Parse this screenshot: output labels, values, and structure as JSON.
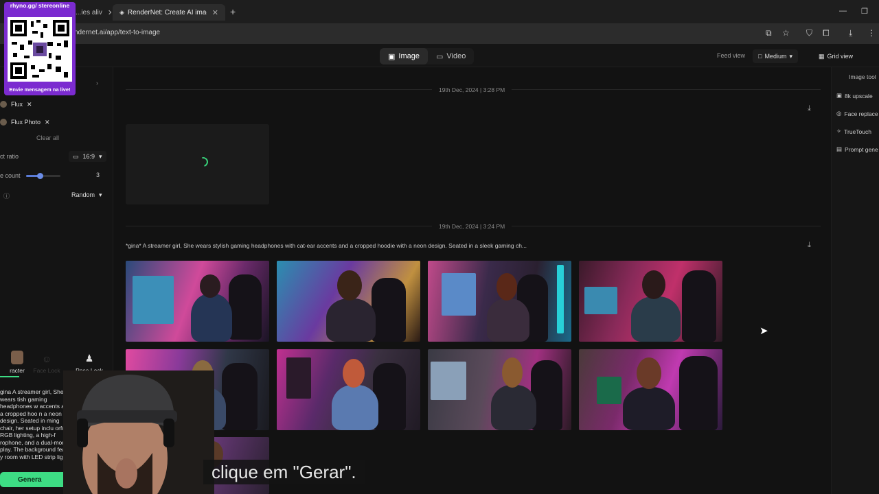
{
  "browser": {
    "tabs": [
      {
        "label": "...ies aliv"
      },
      {
        "label": "RenderNet: Create AI images w"
      }
    ],
    "url": "ndernet.ai/app/text-to-image"
  },
  "header": {
    "modes": [
      {
        "label": "Image",
        "active": true
      },
      {
        "label": "Video",
        "active": false
      }
    ],
    "feed_view_label": "Feed view",
    "size_label": "Medium",
    "grid_view_label": "Grid view"
  },
  "left_panel": {
    "models": [
      {
        "label": "Flux"
      },
      {
        "label": "Flux Photo"
      }
    ],
    "clear_all": "Clear all",
    "aspect_ratio_label": "ct ratio",
    "aspect_ratio_value": "16:9",
    "image_count_label": "e count",
    "image_count_value": "3",
    "image_count_fraction": 0.4,
    "seed_value": "Random",
    "locks": [
      {
        "label": "racter",
        "icon": "character-icon"
      },
      {
        "label": "Face Lock",
        "icon": "face-icon"
      },
      {
        "label": "Pose Lock",
        "icon": "pose-icon"
      }
    ],
    "prompt_text": "gina A streamer girl, She wears tish gaming headphones w accents and a cropped hoo n a neon design. Seated in ming chair, her setup inclu orful RGB lighting, a high-f rophone, and a dual-monit play. The background featu y room with LED strip lig",
    "generate_label": "Genera"
  },
  "right_panel": {
    "title": "Image tool",
    "tools": [
      {
        "label": "8k upscale",
        "icon": "upscale-icon"
      },
      {
        "label": "Face replace",
        "icon": "face-replace-icon"
      },
      {
        "label": "TrueTouch",
        "icon": "truetouch-icon"
      },
      {
        "label": "Prompt gene",
        "icon": "prompt-gen-icon"
      }
    ]
  },
  "feed": {
    "groups": [
      {
        "date": "19th Dec, 2024 | 3:28 PM",
        "status": "loading"
      },
      {
        "date": "19th Dec, 2024 | 3:24 PM",
        "prompt": "*gina* A streamer girl, She wears stylish gaming headphones with cat-ear accents and a cropped hoodie with a neon design. Seated in a sleek gaming ch..."
      }
    ]
  },
  "overlay": {
    "qr_header": "rhyno.gg/ stereonline",
    "qr_footer": "Envie mensagem na live!",
    "subtitle": "clique em \"Gerar\"."
  }
}
